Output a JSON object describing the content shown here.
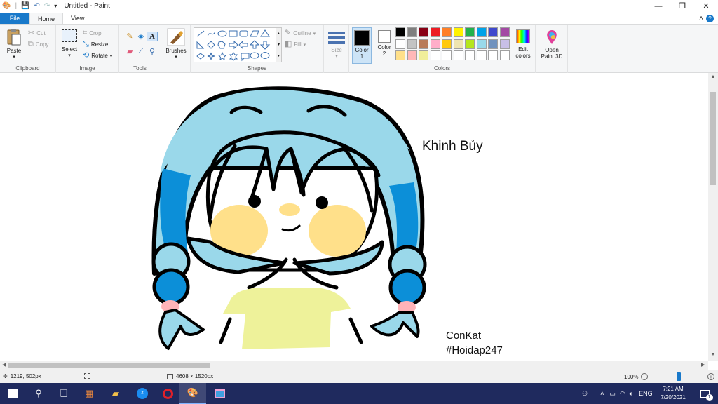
{
  "titlebar": {
    "title": "Untitled - Paint",
    "qat_separator": "|",
    "minimize": "—",
    "maximize": "❐",
    "close": "✕"
  },
  "tabs": {
    "file": "File",
    "home": "Home",
    "view": "View"
  },
  "ribbon": {
    "clipboard": {
      "paste": "Paste",
      "cut": "Cut",
      "copy": "Copy",
      "label": "Clipboard"
    },
    "image": {
      "select": "Select",
      "crop": "Crop",
      "resize": "Resize",
      "rotate": "Rotate",
      "label": "Image"
    },
    "tools": {
      "label": "Tools"
    },
    "brushes": {
      "label": "Brushes"
    },
    "shapes": {
      "outline": "Outline",
      "fill": "Fill",
      "label": "Shapes"
    },
    "size": {
      "label": "Size"
    },
    "colors": {
      "color1": "Color 1",
      "color1_line1": "Color",
      "color1_line2": "1",
      "color2_line1": "Color",
      "color2_line2": "2",
      "edit_line1": "Edit",
      "edit_line2": "colors",
      "label": "Colors",
      "color1_value": "#000000",
      "color2_value": "#ffffff",
      "palette": [
        "#000000",
        "#7f7f7f",
        "#880015",
        "#ed1c24",
        "#ff7f27",
        "#fff200",
        "#22b14c",
        "#00a2e8",
        "#3f48cc",
        "#a349a4",
        "#ffffff",
        "#c3c3c3",
        "#b97a57",
        "#ffaec9",
        "#ffc90e",
        "#efe4b0",
        "#b5e61d",
        "#99d9ea",
        "#7092be",
        "#c8bfe7",
        "#ffe08a",
        "#ffb8b8",
        "#f0ee9a",
        "#ffffff",
        "#ffffff",
        "#ffffff",
        "#ffffff",
        "#ffffff",
        "#ffffff",
        "#ffffff"
      ]
    },
    "paint3d": {
      "line1": "Open",
      "line2": "Paint 3D"
    }
  },
  "canvas": {
    "text_title": "Khinh Bủy",
    "text_author": "ConKat",
    "text_tag": "#Hoidap247",
    "colors": {
      "hair_light": "#9ad8ea",
      "hair_dark": "#0c8fd8",
      "cheek": "#ffe08a",
      "shirt": "#eef29a",
      "hair_tie": "#ffb3b8",
      "outline": "#000000"
    }
  },
  "statusbar": {
    "cursor_pos": "1219, 502px",
    "image_size": "4608 × 1520px",
    "zoom": "100%"
  },
  "taskbar": {
    "lang": "ENG",
    "time": "7:21 AM",
    "date": "7/20/2021",
    "notif_count": "1"
  }
}
